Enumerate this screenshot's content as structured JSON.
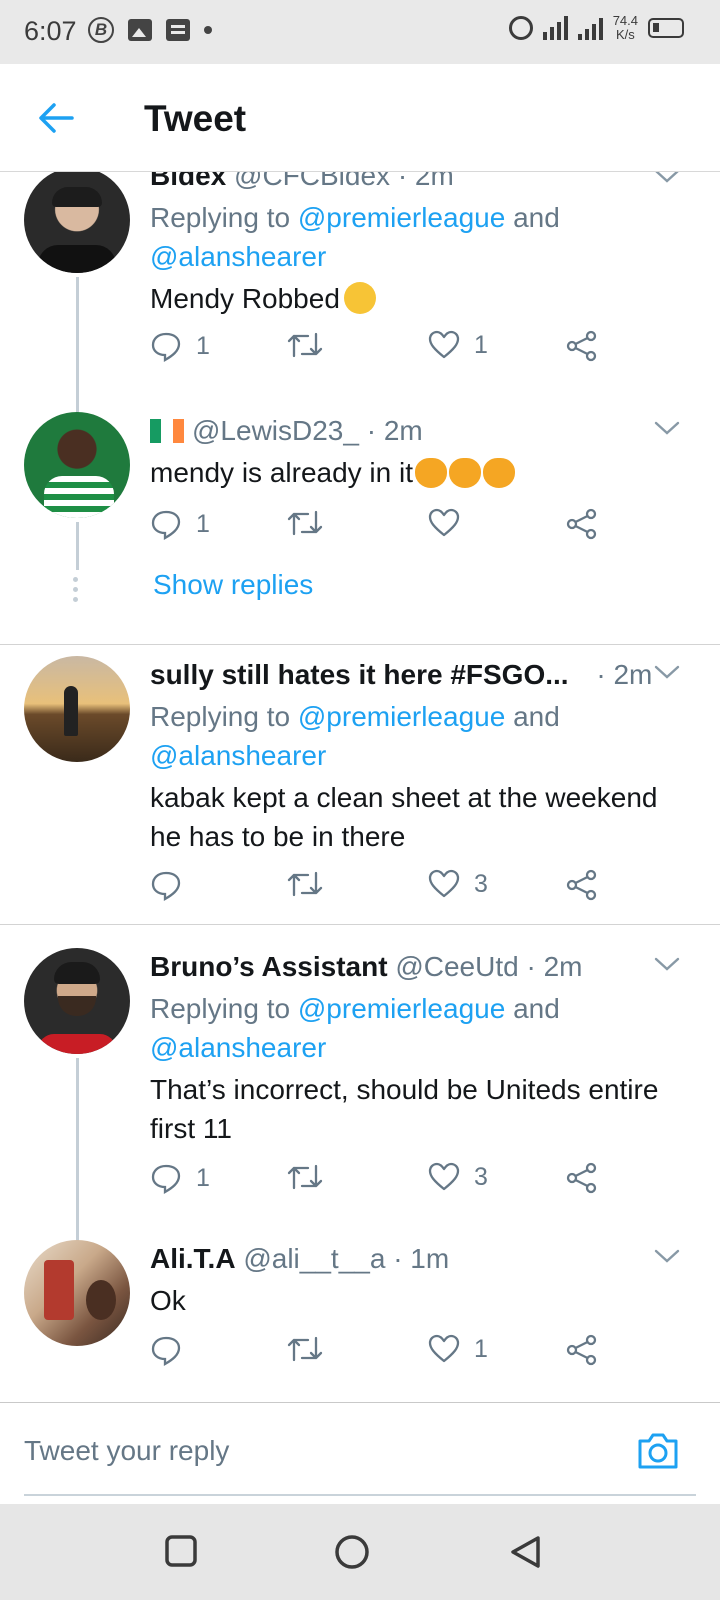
{
  "status_bar": {
    "time": "6:07",
    "network_speed": "74.4",
    "network_unit": "K/s",
    "network_type": "4G"
  },
  "header": {
    "title": "Tweet"
  },
  "tweets": [
    {
      "name": "Bidex",
      "handle": "@CFCBidex",
      "time": "· 2m",
      "reply_prefix": "Replying to ",
      "mention1": "@premierleague",
      "and": " and",
      "mention2": "@alanshearer",
      "text": "Mendy Robbed",
      "replies": "1",
      "retweets": "",
      "likes": "1"
    },
    {
      "name": "",
      "handle": "@LewisD23_",
      "time": "· 2m",
      "text": "mendy is already in it",
      "replies": "1",
      "retweets": "",
      "likes": "",
      "show_replies": "Show replies"
    },
    {
      "name": "sully still hates it here #FSGO...",
      "handle": "",
      "time": "· 2m",
      "reply_prefix": "Replying to ",
      "mention1": "@premierleague",
      "and": " and",
      "mention2": "@alanshearer",
      "text": "kabak kept a clean sheet at the weekend he has to be in there",
      "replies": "",
      "retweets": "",
      "likes": "3"
    },
    {
      "name": "Bruno’s Assistant",
      "handle": "@CeeUtd",
      "time": "· 2m",
      "reply_prefix": "Replying to ",
      "mention1": "@premierleague",
      "and": " and",
      "mention2": "@alanshearer",
      "text": "That’s incorrect, should be Uniteds entire first 11",
      "replies": "1",
      "retweets": "",
      "likes": "3"
    },
    {
      "name": "Ali.T.A",
      "handle": "@ali__t__a",
      "time": "· 1m",
      "text": "Ok",
      "replies": "",
      "retweets": "",
      "likes": "1"
    }
  ],
  "reply_bar": {
    "placeholder": "Tweet your reply"
  },
  "colors": {
    "accent": "#1da1f2",
    "secondary_text": "#657786",
    "primary_text": "#14171a"
  }
}
